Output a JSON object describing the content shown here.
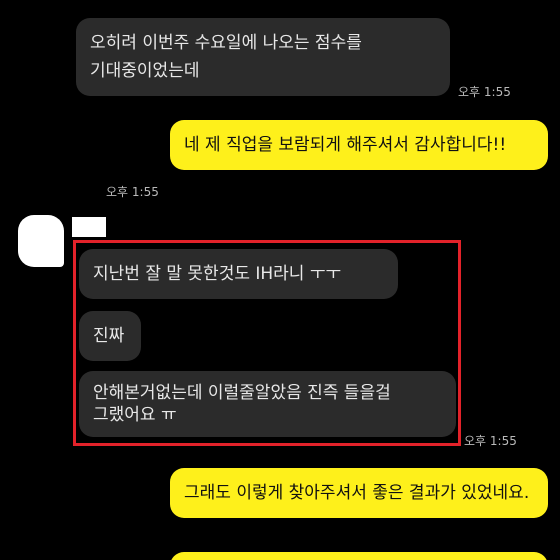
{
  "colors": {
    "background": "#000000",
    "incoming_bubble": "#2b2b2b",
    "outgoing_bubble": "#fef01b",
    "highlight_border": "#e3222a"
  },
  "messages": {
    "m1": {
      "text": "오히려 이번주 수요일에 나오는 점수를 기대중이었는데",
      "time": "오후 1:55"
    },
    "m2": {
      "text": "네 제 직업을 보람되게 해주셔서 감사합니다!!",
      "time": "오후 1:55"
    },
    "m3": {
      "text": "지난번 잘 말 못한것도 IH라니 ㅜㅜ"
    },
    "m4": {
      "text": "진짜"
    },
    "m5": {
      "text": "안해본거없는데 이럴줄알았음 진즉 들을걸 그랬어요 ㅠ",
      "time": "오후 1:55"
    },
    "m6": {
      "text": "그래도 이렇게 찾아주셔서 좋은 결과가 있었네요."
    }
  }
}
